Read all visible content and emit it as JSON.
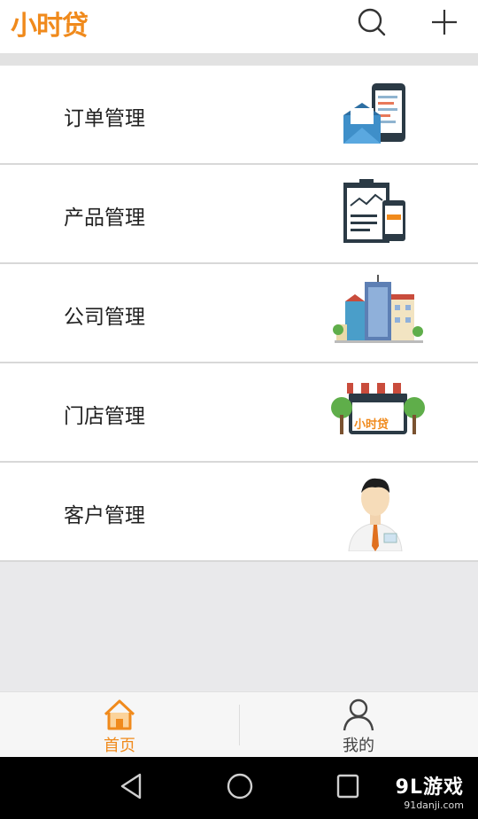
{
  "header": {
    "logo_text": "小时贷",
    "brand_color": "#f08a1c"
  },
  "menu": {
    "items": [
      {
        "label": "订单管理",
        "icon": "order-illustration"
      },
      {
        "label": "产品管理",
        "icon": "product-illustration"
      },
      {
        "label": "公司管理",
        "icon": "company-illustration"
      },
      {
        "label": "门店管理",
        "icon": "store-illustration"
      },
      {
        "label": "客户管理",
        "icon": "customer-illustration"
      }
    ]
  },
  "store_sign": "小时贷",
  "tabbar": {
    "home_label": "首页",
    "profile_label": "我的",
    "active_color": "#f08a1c",
    "inactive_color": "#444444"
  },
  "watermark": {
    "title": "9L游戏",
    "site": "91danji.com"
  }
}
